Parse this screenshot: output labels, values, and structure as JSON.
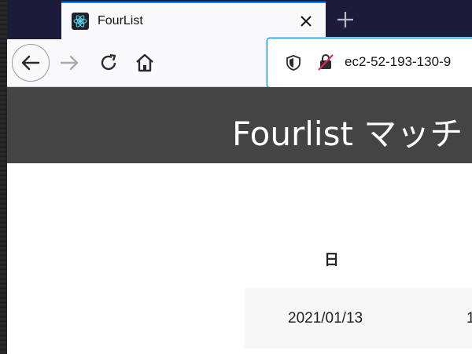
{
  "browser": {
    "tab": {
      "title": "FourList",
      "favicon": "react-atom-icon",
      "close_icon": "close-icon"
    },
    "new_tab_icon": "plus-icon",
    "nav": {
      "back_icon": "arrow-left-icon",
      "forward_icon": "arrow-right-icon",
      "reload_icon": "reload-icon",
      "home_icon": "home-icon"
    },
    "url_bar": {
      "shield_icon": "shield-icon",
      "insecure_icon": "insecure-lock-icon",
      "url": "ec2-52-193-130-9"
    }
  },
  "app": {
    "header_title": "Fourlist マッチ"
  },
  "table": {
    "headers": [
      "日"
    ],
    "rows": [
      {
        "date": "2021/01/13",
        "next": "1"
      }
    ]
  },
  "colors": {
    "titlebar": "#1c1b3a",
    "accent": "#0a84ff",
    "app_header": "#444444",
    "row_bg": "#f7f7f7"
  }
}
